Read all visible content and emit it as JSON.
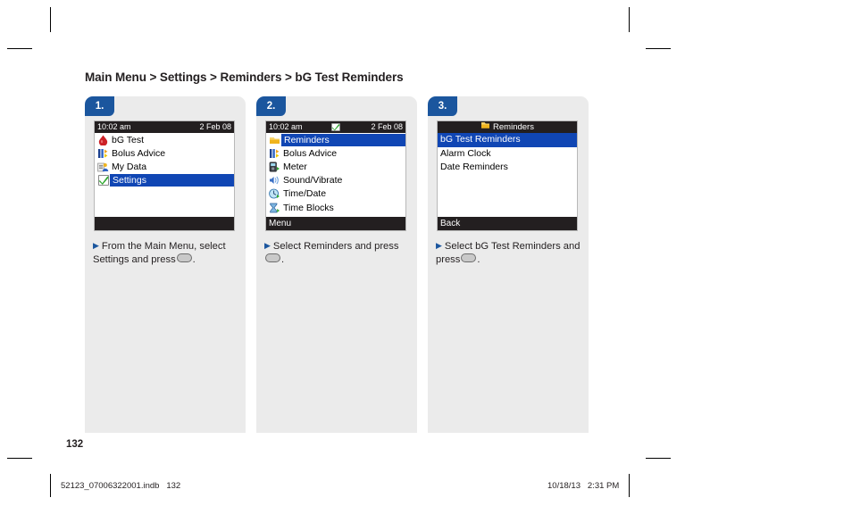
{
  "breadcrumb": "Main Menu > Settings > Reminders > bG Test Reminders",
  "page_number": "132",
  "footer": {
    "file": "52123_07006322001.indb   132",
    "timestamp": "10/18/13   2:31 PM"
  },
  "colors": {
    "accent_blue": "#1b569e",
    "selection_blue": "#1046b4",
    "card_gray": "#ebebeb",
    "screen_black": "#231f20",
    "blood_red": "#cc2127",
    "check_green": "#2fa82f"
  },
  "steps": [
    {
      "badge": "1.",
      "screen": {
        "statusbar": {
          "time": "10:02 am",
          "date": "2 Feb 08",
          "mid_icon": ""
        },
        "items": [
          {
            "label": "bG Test",
            "icon": "blood-drop-icon",
            "selected": false
          },
          {
            "label": "Bolus Advice",
            "icon": "bolus-advice-icon",
            "selected": false
          },
          {
            "label": "My Data",
            "icon": "my-data-icon",
            "selected": false
          },
          {
            "label": "Settings",
            "icon": "settings-check-icon",
            "selected": true
          }
        ],
        "softkey": ""
      },
      "caption_line1": "From the Main Menu, select",
      "caption_line2_pre": "Settings and press",
      "caption_line2_post": "."
    },
    {
      "badge": "2.",
      "screen": {
        "statusbar": {
          "time": "10:02 am",
          "date": "2 Feb 08",
          "mid_icon": "battery-icon"
        },
        "items": [
          {
            "label": "Reminders",
            "icon": "reminders-icon",
            "selected": true
          },
          {
            "label": "Bolus Advice",
            "icon": "bolus-advice-icon",
            "selected": false
          },
          {
            "label": "Meter",
            "icon": "meter-icon",
            "selected": false
          },
          {
            "label": "Sound/Vibrate",
            "icon": "sound-vibrate-icon",
            "selected": false
          },
          {
            "label": "Time/Date",
            "icon": "time-date-icon",
            "selected": false
          },
          {
            "label": "Time Blocks",
            "icon": "time-blocks-icon",
            "selected": false
          }
        ],
        "softkey": "Menu"
      },
      "caption_line1_pre": "Select Reminders and press",
      "caption_line2_post": "."
    },
    {
      "badge": "3.",
      "screen": {
        "title": "Reminders",
        "title_icon": "reminders-icon",
        "items": [
          {
            "label": "bG Test Reminders",
            "selected": true
          },
          {
            "label": "Alarm Clock",
            "selected": false
          },
          {
            "label": "Date Reminders",
            "selected": false
          }
        ],
        "softkey": "Back"
      },
      "caption_line1": "Select bG Test Reminders and",
      "caption_line2_pre": "press",
      "caption_line2_post": "."
    }
  ]
}
